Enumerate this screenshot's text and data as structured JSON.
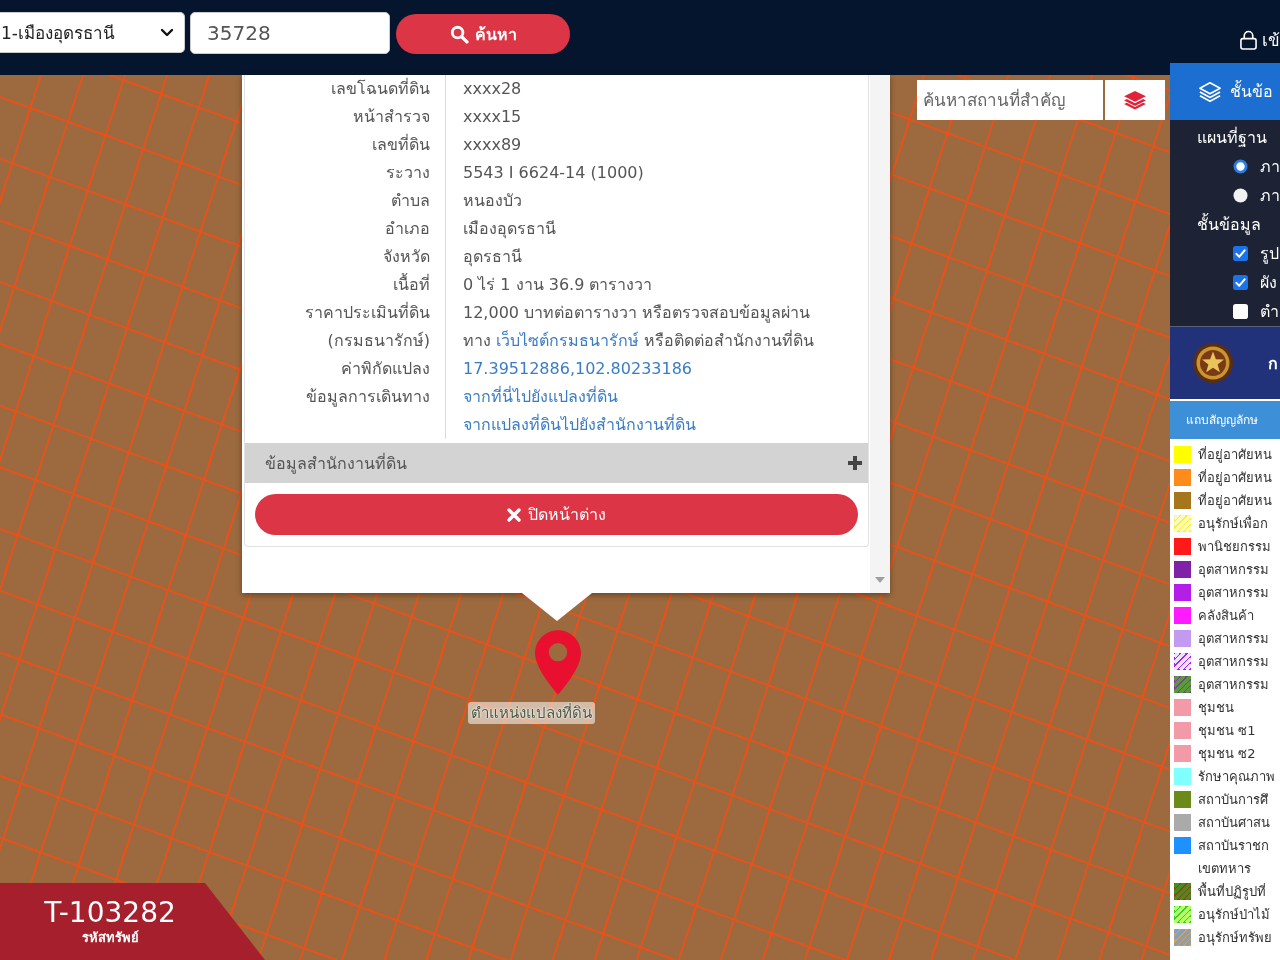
{
  "top_bar": {
    "district_select": {
      "value": "1-เมืองอุดรธานี"
    },
    "parcel_field": {
      "value": "35728"
    },
    "search_button": {
      "label": "ค้นหา"
    },
    "login_link": {
      "label": "เข้"
    }
  },
  "map": {
    "search_field": {
      "placeholder": "ค้นหาสถานที่สำคัญ"
    },
    "pin_label": "ตำแหน่งแปลงที่ดิน",
    "listing_badge": {
      "code": "T-103282",
      "caption": "รหัสทรัพย์"
    }
  },
  "parcel_popup": {
    "rows": [
      {
        "kind": "text",
        "label": "เลขโฉนดที่ดิน",
        "value": "xxxx28"
      },
      {
        "kind": "text",
        "label": "หน้าสำรวจ",
        "value": "xxxx15"
      },
      {
        "kind": "text",
        "label": "เลขที่ดิน",
        "value": "xxxx89"
      },
      {
        "kind": "text",
        "label": "ระวาง",
        "value": "5543 I 6624-14 (1000)"
      },
      {
        "kind": "text",
        "label": "ตำบล",
        "value": "หนองบัว"
      },
      {
        "kind": "text",
        "label": "อำเภอ",
        "value": "เมืองอุดรธานี"
      },
      {
        "kind": "text",
        "label": "จังหวัด",
        "value": "อุดรธานี"
      },
      {
        "kind": "text",
        "label": "เนื้อที่",
        "value": "0 ไร่ 1 งาน 36.9 ตารางวา"
      },
      {
        "kind": "note",
        "label": "ราคาประเมินที่ดิน (กรมธนารักษ์)",
        "text_before": "12,000 บาทต่อตารางวา หรือตรวจสอบข้อมูลผ่าน ทาง",
        "link": "เว็บไซต์กรมธนารักษ์",
        "text_after": "หรือติดต่อสำนักงานที่ดิน"
      },
      {
        "kind": "link",
        "label": "ค่าพิกัดแปลง",
        "value": "17.39512886,102.80233186"
      },
      {
        "kind": "links",
        "label": "ข้อมูลการเดินทาง",
        "links": [
          "จากที่นี่ไปยังแปลงที่ดิน",
          "จากแปลงที่ดินไปยังสำนักงานที่ดิน"
        ]
      }
    ],
    "section": {
      "label": "ข้อมูลสำนักงานที่ดิน",
      "expanded": false
    },
    "close_button": {
      "label": "ปิดหน้าต่าง"
    }
  },
  "layer_panel": {
    "header": "ชั้นข้อ",
    "basemap_heading": "แผนที่ฐาน",
    "basemaps": [
      {
        "label": "ภา",
        "selected": true
      },
      {
        "label": "ภา",
        "selected": false
      }
    ],
    "layers_heading": "ชั้นข้อมูล",
    "layers": [
      {
        "label": "รูป",
        "checked": true
      },
      {
        "label": "ผัง",
        "checked": true
      },
      {
        "label": "ตำ",
        "checked": false
      }
    ],
    "agency": {
      "label": "ก"
    },
    "legend": {
      "title": "แถบสัญญลักษ",
      "items": [
        {
          "kind": "solid",
          "label": "ที่อยู่อาศัยหน",
          "color": "#ffff00"
        },
        {
          "kind": "solid",
          "label": "ที่อยู่อาศัยหน",
          "color": "#ff8c1a"
        },
        {
          "kind": "solid",
          "label": "ที่อยู่อาศัยหน",
          "color": "#a6761d"
        },
        {
          "kind": "hatched",
          "label": "อนุรักษ์เพื่อก",
          "color": "#f2f230",
          "stripe": {
            "color": "#fcf9c0"
          }
        },
        {
          "kind": "solid",
          "label": "พานิชยกรรม",
          "color": "#ff1a1a"
        },
        {
          "kind": "solid",
          "label": "อุตสาหกรรม",
          "color": "#7f22a8"
        },
        {
          "kind": "solid",
          "label": "อุตสาหกรรม",
          "color": "#b41fe8"
        },
        {
          "kind": "solid",
          "label": "คลังสินค้า",
          "color": "#ff1aff"
        },
        {
          "kind": "solid",
          "label": "อุตสาหกรรม",
          "color": "#c49af0"
        },
        {
          "kind": "hatched",
          "label": "อุตสาหกรรม",
          "color": "#a020f0",
          "stripe": {
            "color": "#f1e2fb"
          }
        },
        {
          "kind": "hatched",
          "label": "อุตสาหกรรม",
          "color": "#7b3fa0",
          "stripe": {
            "color": "#5a9a3a"
          }
        },
        {
          "kind": "solid",
          "label": "ชุมชน",
          "color": "#f29aa8"
        },
        {
          "kind": "solid",
          "label": "ชุมชน ซ1",
          "color": "#f29aa8"
        },
        {
          "kind": "solid",
          "label": "ชุมชน ซ2",
          "color": "#f29aa8"
        },
        {
          "kind": "solid",
          "label": "รักษาคุณภาพ",
          "color": "#80ffff"
        },
        {
          "kind": "solid",
          "label": "สถาบันการศึ",
          "color": "#6a8a1a"
        },
        {
          "kind": "solid",
          "label": "สถาบันศาสน",
          "color": "#aaaaaa"
        },
        {
          "kind": "solid",
          "label": "สถาบันราชก",
          "color": "#1e90ff"
        },
        {
          "kind": "blank",
          "label": "เขตทหาร"
        },
        {
          "kind": "hatched",
          "label": "พื้นที่ปฏิรูปที่",
          "color": "#8b4513",
          "stripe": {
            "color": "#4a8a20"
          }
        },
        {
          "kind": "hatched",
          "label": "อนุรักษ์ป่าไม้",
          "color": "#33cc33",
          "stripe": {
            "color": "#b3ff66"
          }
        },
        {
          "kind": "hatched",
          "label": "อนุรักษ์ทรัพย",
          "color": "#d9a05b",
          "stripe": {
            "color": "#8aa0b0"
          }
        }
      ]
    }
  }
}
